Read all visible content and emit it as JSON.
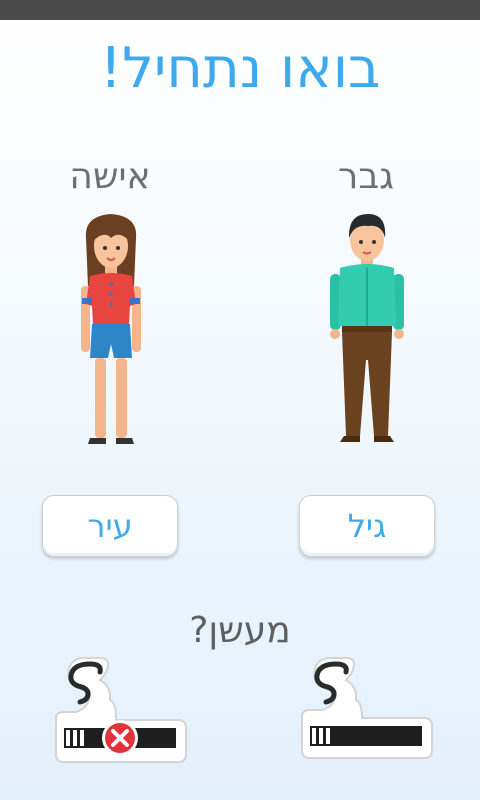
{
  "header": {
    "title": "בואו נתחיל!"
  },
  "gender": {
    "female_label": "אישה",
    "male_label": "גבר"
  },
  "fields": {
    "city_label": "עיר",
    "age_label": "גיל"
  },
  "smoking": {
    "question": "מעשן?",
    "non_smoker_icon": "no-cigarette-icon",
    "smoker_icon": "cigarette-icon"
  },
  "colors": {
    "accent": "#3ea9ec",
    "status_bar": "#4a4a4a",
    "label_gray": "#6f6f6f",
    "cross_red": "#e2323c"
  }
}
